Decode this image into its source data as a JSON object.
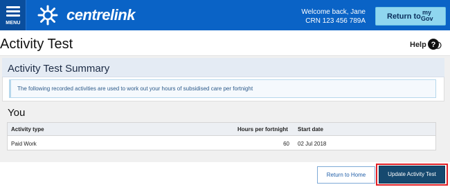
{
  "header": {
    "menu_label": "MENU",
    "app_name": "centrelink",
    "welcome_text": "Welcome back, Jane",
    "crn_text": "CRN 123 456 789A",
    "mygov_button": {
      "label": "Return to",
      "brand_top": "my",
      "brand_bottom": "Gov"
    }
  },
  "page": {
    "title": "Activity Test",
    "help_label": "Help"
  },
  "summary": {
    "title": "Activity Test Summary",
    "info_text": "The following recorded activities are used to work out your hours of subsidised care per fortnight"
  },
  "you_section": {
    "title": "You",
    "table": {
      "columns": [
        "Activity type",
        "Hours per fortnight",
        "Start date"
      ],
      "rows": [
        {
          "activity_type": "Paid Work",
          "hours": "60",
          "start_date": "02 Jul 2018"
        }
      ]
    }
  },
  "footer": {
    "return_home_label": "Return to Home",
    "update_label": "Update Activity Test"
  },
  "icons": [
    "menu-icon",
    "centrelink-star-logo-icon",
    "help-question-icon"
  ],
  "colors": {
    "header_blue": "#0a63c6",
    "mygov_button": "#8fd6ef",
    "primary_button": "#16496f",
    "highlight_outline": "#e01e24"
  }
}
